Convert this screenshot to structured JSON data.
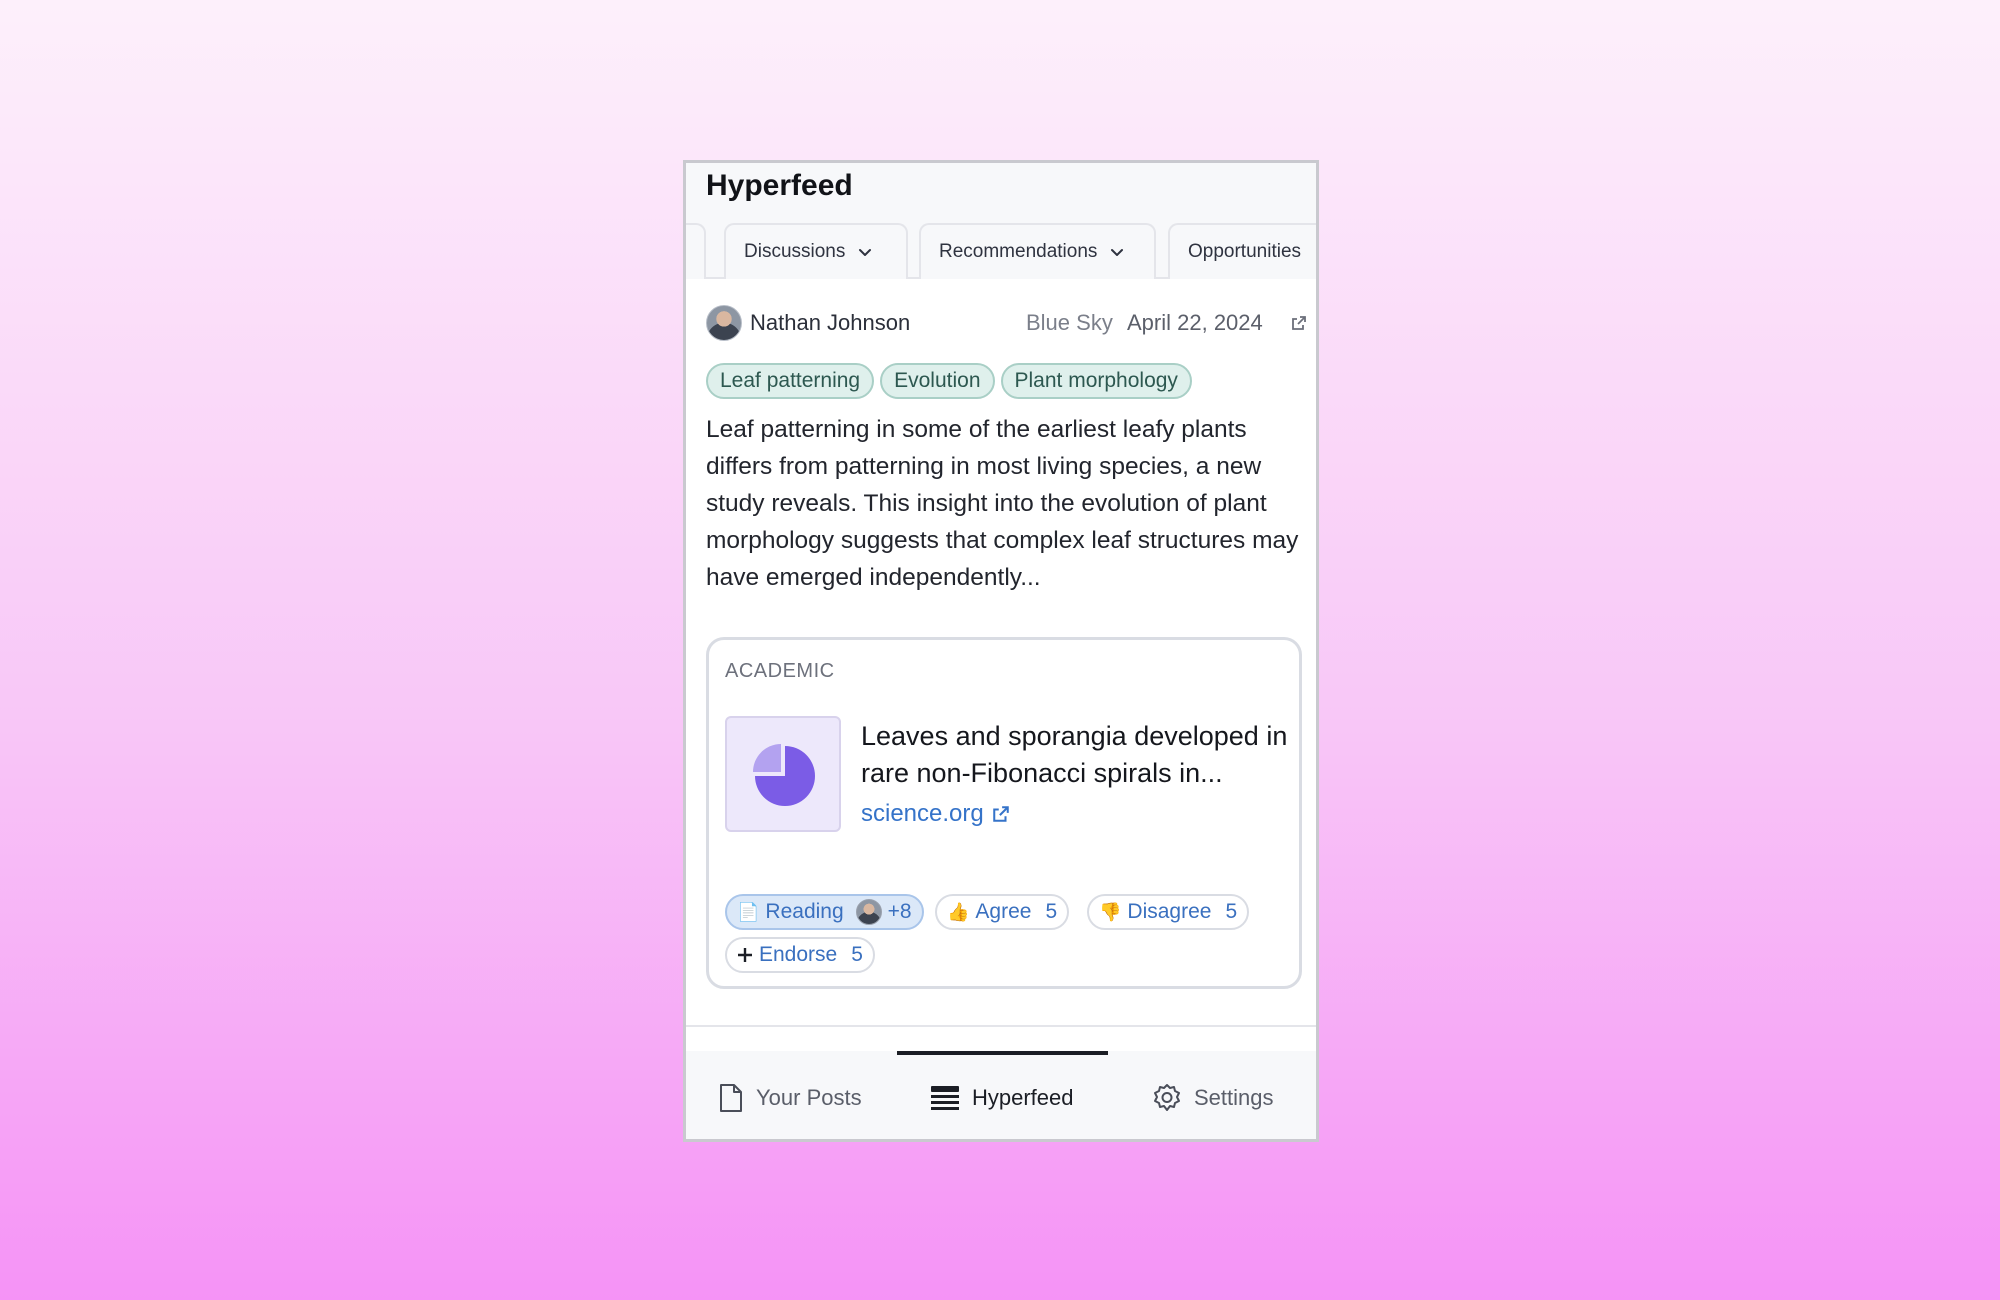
{
  "app": {
    "title": "Hyperfeed"
  },
  "tabs": [
    {
      "label": "Discussions",
      "has_dropdown": true
    },
    {
      "label": "Recommendations",
      "has_dropdown": true
    },
    {
      "label": "Opportunities",
      "has_dropdown": false
    }
  ],
  "post": {
    "author": "Nathan Johnson",
    "source": "Blue Sky",
    "date": "April 22, 2024",
    "tags": [
      "Leaf patterning",
      "Evolution",
      "Plant morphology"
    ],
    "body": "Leaf patterning in some of the earliest leafy plants differs from patterning in most living species, a new study reveals. This insight into the evolution of plant morphology suggests that complex leaf structures may have emerged independently...",
    "card": {
      "label": "ACADEMIC",
      "title": "Leaves and sporangia developed in rare non-Fibonacci spirals in...",
      "link": "science.org"
    },
    "reactions": {
      "reading": {
        "label": "Reading",
        "extra": "+8"
      },
      "agree": {
        "label": "Agree",
        "count": "5"
      },
      "disagree": {
        "label": "Disagree",
        "count": "5"
      },
      "endorse": {
        "label": "Endorse",
        "count": "5"
      }
    }
  },
  "bottom_nav": [
    {
      "label": "Your Posts",
      "icon": "document-icon",
      "active": false
    },
    {
      "label": "Hyperfeed",
      "icon": "feed-icon",
      "active": true
    },
    {
      "label": "Settings",
      "icon": "gear-icon",
      "active": false
    }
  ],
  "colors": {
    "accent": "#3573c9",
    "tag_bg": "#dff0ec",
    "tag_text": "#2d5850",
    "thumb_purple": "#7b5ce6"
  }
}
